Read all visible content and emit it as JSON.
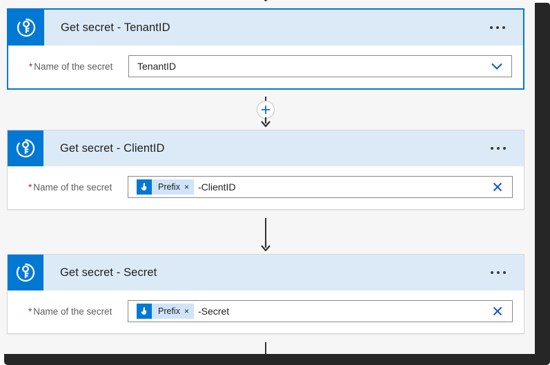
{
  "workflow": {
    "steps": [
      {
        "icon": "key-vault-icon",
        "title": "Get secret - TenantID",
        "selected": true,
        "menu_icon": "ellipsis-icon",
        "field": {
          "label": "Name of the secret",
          "required_marker": "*",
          "value": "TenantID",
          "trailing_icon": "chevron-down-icon",
          "token": null
        }
      },
      {
        "icon": "key-vault-icon",
        "title": "Get secret - ClientID",
        "selected": false,
        "menu_icon": "ellipsis-icon",
        "field": {
          "label": "Name of the secret",
          "required_marker": "*",
          "value": "",
          "trailing_icon": "clear-x-icon",
          "token": {
            "icon": "trigger-hand-icon",
            "label": "Prefix",
            "remove_icon": "×",
            "suffix": "-ClientID"
          }
        }
      },
      {
        "icon": "key-vault-icon",
        "title": "Get secret - Secret",
        "selected": false,
        "menu_icon": "ellipsis-icon",
        "field": {
          "label": "Name of the secret",
          "required_marker": "*",
          "value": "",
          "trailing_icon": "clear-x-icon",
          "token": {
            "icon": "trigger-hand-icon",
            "label": "Prefix",
            "remove_icon": "×",
            "suffix": "-Secret"
          }
        }
      }
    ],
    "connectors": [
      {
        "type": "arrow",
        "has_plus": false
      },
      {
        "type": "arrow",
        "has_plus": true
      },
      {
        "type": "arrow",
        "has_plus": false
      },
      {
        "type": "arrow",
        "has_plus": false
      }
    ]
  },
  "colors": {
    "accent": "#0078d4",
    "header_fill": "#dceaf7",
    "token_fill": "#cfe4fa",
    "required": "#a4262c",
    "surface": "#f6f6f6",
    "frame": "#262626"
  }
}
